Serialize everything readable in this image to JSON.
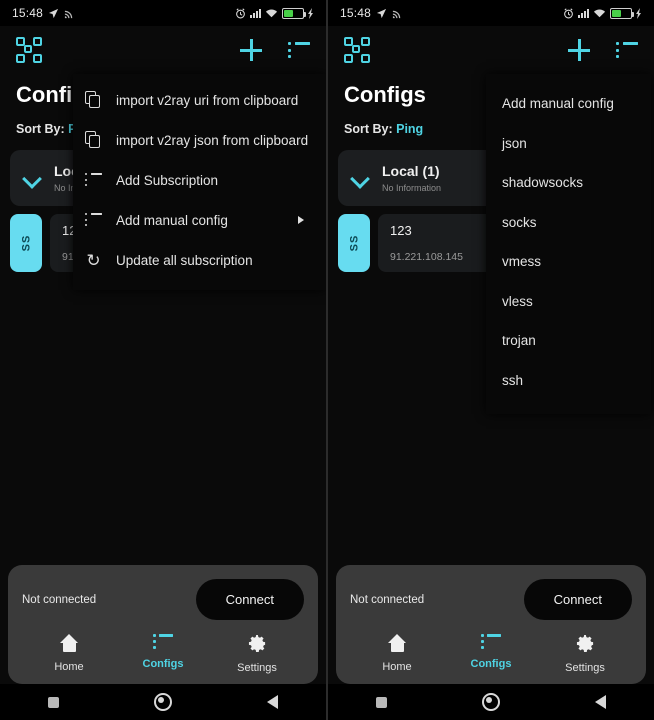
{
  "status_bar": {
    "time": "15:48",
    "icons_left": [
      "location-arrow-icon",
      "cast-icon"
    ],
    "icons_right": [
      "alarm-icon",
      "signal-icon",
      "wifi-icon",
      "battery-charging-icon"
    ]
  },
  "header": {
    "qr_icon": "qr-scan-icon",
    "add_icon": "plus-icon",
    "menu_icon": "list-menu-icon"
  },
  "page": {
    "title": "Configs",
    "sort_label": "Sort By:",
    "sort_value": "Ping"
  },
  "group": {
    "name": "Local (1)",
    "subtitle": "No Information",
    "chevron_icon": "chevron-down-icon"
  },
  "config": {
    "badge": "SS",
    "name": "123",
    "address": "91.221.108.145",
    "address_truncated": "91.22"
  },
  "bottom": {
    "connection_status": "Not connected",
    "connect_label": "Connect",
    "nav": [
      {
        "label": "Home",
        "icon": "home-icon",
        "active": false
      },
      {
        "label": "Configs",
        "icon": "list-icon",
        "active": true
      },
      {
        "label": "Settings",
        "icon": "gear-icon",
        "active": false
      }
    ]
  },
  "android_nav": {
    "recents": "square-recents-icon",
    "home": "circle-home-icon",
    "back": "triangle-back-icon"
  },
  "left_menu": {
    "items": [
      {
        "label": "import v2ray uri from clipboard",
        "icon": "copy-icon",
        "submenu": false
      },
      {
        "label": "import v2ray json from clipboard",
        "icon": "copy-icon",
        "submenu": false
      },
      {
        "label": "Add Subscription",
        "icon": "list-icon",
        "submenu": false
      },
      {
        "label": "Add manual config",
        "icon": "list-icon",
        "submenu": true
      },
      {
        "label": "Update all subscription",
        "icon": "refresh-icon",
        "submenu": false
      }
    ]
  },
  "right_menu": {
    "items": [
      {
        "label": "Add manual config"
      },
      {
        "label": "json"
      },
      {
        "label": "shadowsocks"
      },
      {
        "label": "socks"
      },
      {
        "label": "vmess"
      },
      {
        "label": "vless"
      },
      {
        "label": "trojan"
      },
      {
        "label": "ssh"
      }
    ]
  },
  "colors": {
    "accent": "#4fd4e4",
    "badge": "#67dcf0",
    "background": "#0a0a0a",
    "card": "#3a3a3a"
  }
}
